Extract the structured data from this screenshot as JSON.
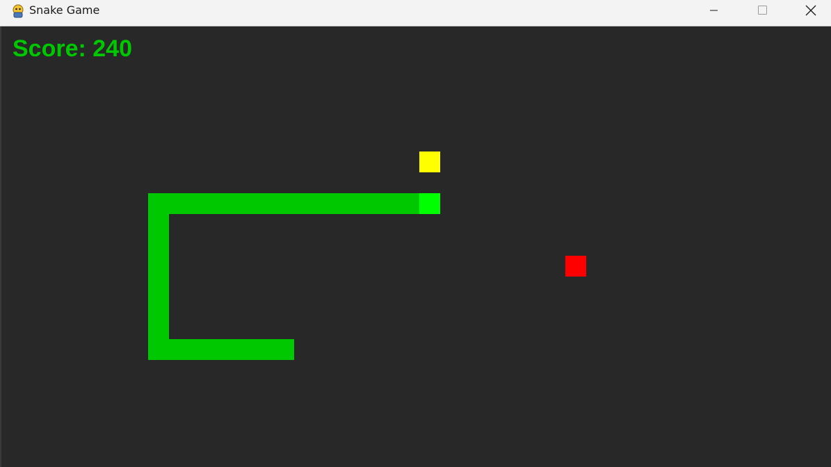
{
  "window": {
    "title": "Snake Game"
  },
  "icons": {
    "app": "python-snake-icon",
    "minimize": "minimize-icon",
    "maximize": "maximize-icon",
    "close": "close-icon"
  },
  "game": {
    "score_text": "Score: 240",
    "colors": {
      "background": "#282828",
      "score": "#00c800",
      "snake_body": "#00c800",
      "snake_head": "#00ff00",
      "food": "#ff0000",
      "bonus": "#ffff00"
    },
    "grid_unit": "cell",
    "snake": {
      "head": [
        20,
        8
      ],
      "body": [
        [
          19,
          8
        ],
        [
          18,
          8
        ],
        [
          17,
          8
        ],
        [
          16,
          8
        ],
        [
          15,
          8
        ],
        [
          14,
          8
        ],
        [
          13,
          8
        ],
        [
          12,
          8
        ],
        [
          11,
          8
        ],
        [
          10,
          8
        ],
        [
          9,
          8
        ],
        [
          8,
          8
        ],
        [
          7,
          8
        ],
        [
          7,
          9
        ],
        [
          7,
          10
        ],
        [
          7,
          11
        ],
        [
          7,
          12
        ],
        [
          7,
          13
        ],
        [
          7,
          14
        ],
        [
          7,
          15
        ],
        [
          8,
          15
        ],
        [
          9,
          15
        ],
        [
          10,
          15
        ],
        [
          11,
          15
        ],
        [
          12,
          15
        ],
        [
          13,
          15
        ]
      ]
    },
    "food": [
      27,
      11
    ],
    "bonus_item": [
      20,
      6
    ]
  }
}
